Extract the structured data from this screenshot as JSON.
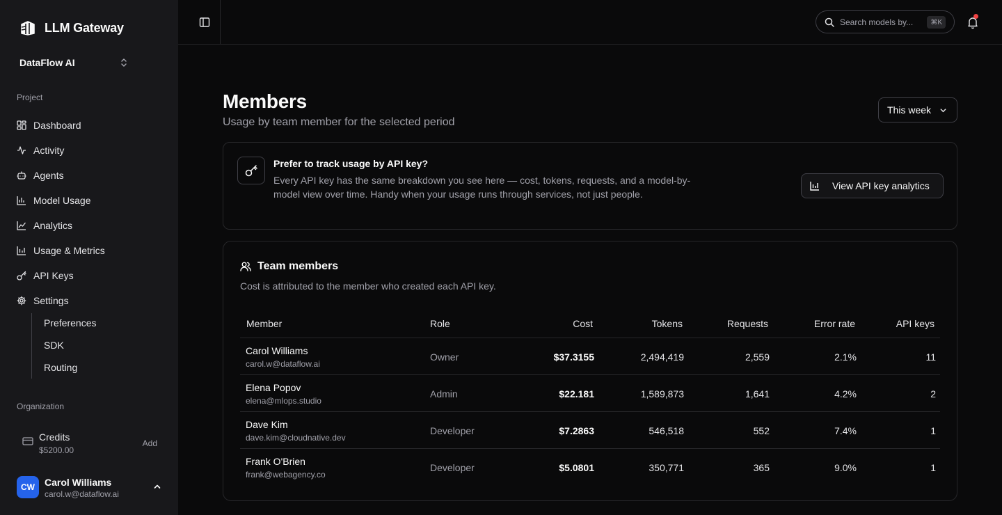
{
  "brand": {
    "name": "LLM Gateway"
  },
  "org_switcher": {
    "name": "DataFlow AI"
  },
  "sidebar": {
    "project_label": "Project",
    "items": [
      {
        "label": "Dashboard",
        "icon": "layout-dashboard-icon"
      },
      {
        "label": "Activity",
        "icon": "activity-icon"
      },
      {
        "label": "Agents",
        "icon": "bot-icon"
      },
      {
        "label": "Model Usage",
        "icon": "bar-chart-icon"
      },
      {
        "label": "Analytics",
        "icon": "line-chart-icon"
      },
      {
        "label": "Usage & Metrics",
        "icon": "bar-chart-icon"
      },
      {
        "label": "API Keys",
        "icon": "key-icon"
      },
      {
        "label": "Settings",
        "icon": "gear-icon"
      }
    ],
    "settings_sub": [
      "Preferences",
      "SDK",
      "Routing"
    ],
    "organization_label": "Organization",
    "credits": {
      "label": "Credits",
      "value": "$5200.00",
      "action": "Add"
    },
    "user": {
      "initials": "CW",
      "name": "Carol Williams",
      "email": "carol.w@dataflow.ai"
    }
  },
  "topbar": {
    "search_placeholder": "Search models by...",
    "search_shortcut": "⌘K"
  },
  "page": {
    "title": "Members",
    "subtitle": "Usage by team member for the selected period",
    "period": "This week"
  },
  "callout": {
    "title": "Prefer to track usage by API key?",
    "body": "Every API key has the same breakdown you see here — cost, tokens, requests, and a model-by-model view over time. Handy when your usage runs through services, not just people.",
    "button": "View API key analytics"
  },
  "team": {
    "title": "Team members",
    "subtitle": "Cost is attributed to the member who created each API key.",
    "columns": [
      "Member",
      "Role",
      "Cost",
      "Tokens",
      "Requests",
      "Error rate",
      "API keys"
    ],
    "rows": [
      {
        "name": "Carol Williams",
        "email": "carol.w@dataflow.ai",
        "role": "Owner",
        "cost": "$37.3155",
        "tokens": "2,494,419",
        "requests": "2,559",
        "error_rate": "2.1%",
        "api_keys": "11"
      },
      {
        "name": "Elena Popov",
        "email": "elena@mlops.studio",
        "role": "Admin",
        "cost": "$22.181",
        "tokens": "1,589,873",
        "requests": "1,641",
        "error_rate": "4.2%",
        "api_keys": "2"
      },
      {
        "name": "Dave Kim",
        "email": "dave.kim@cloudnative.dev",
        "role": "Developer",
        "cost": "$7.2863",
        "tokens": "546,518",
        "requests": "552",
        "error_rate": "7.4%",
        "api_keys": "1"
      },
      {
        "name": "Frank O'Brien",
        "email": "frank@webagency.co",
        "role": "Developer",
        "cost": "$5.0801",
        "tokens": "350,771",
        "requests": "365",
        "error_rate": "9.0%",
        "api_keys": "1"
      }
    ]
  },
  "colors": {
    "accent": "#2563eb",
    "notification": "#ef4444",
    "background": "#0a0a0b",
    "sidebar": "#18181b"
  }
}
